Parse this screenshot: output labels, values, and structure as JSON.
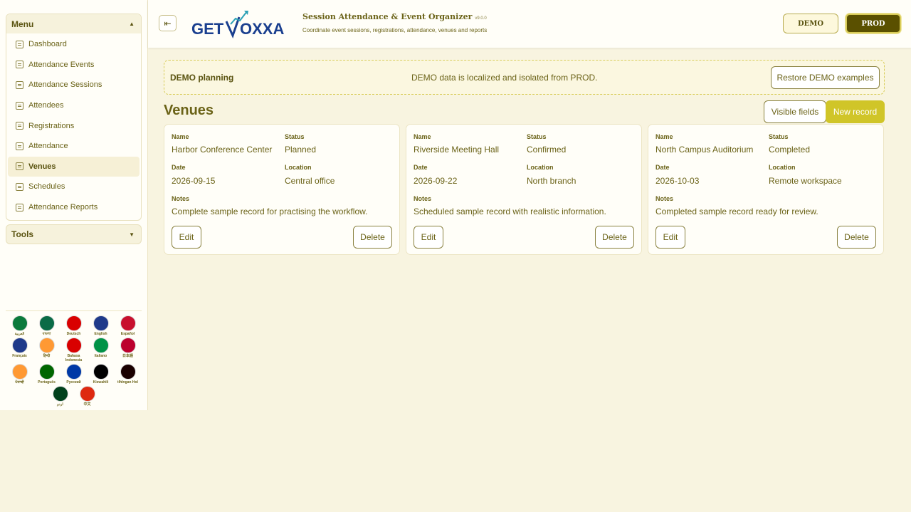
{
  "sidebar": {
    "menu_title": "Menu",
    "items": [
      {
        "label": "Dashboard"
      },
      {
        "label": "Attendance Events"
      },
      {
        "label": "Attendance Sessions"
      },
      {
        "label": "Attendees"
      },
      {
        "label": "Registrations"
      },
      {
        "label": "Attendance"
      },
      {
        "label": "Venues",
        "active": true
      },
      {
        "label": "Schedules"
      },
      {
        "label": "Attendance Reports"
      }
    ],
    "tools_title": "Tools",
    "languages": [
      [
        {
          "name": "العربية",
          "flag_color": "#0b7a3c",
          "icon": "saudi-flag-icon"
        },
        {
          "name": "বাংলা",
          "flag_color": "#0a6b46",
          "icon": "bangladesh-flag-icon"
        },
        {
          "name": "Deutsch",
          "flag_color": "#d90000",
          "icon": "germany-flag-icon"
        },
        {
          "name": "English",
          "flag_color": "#1f3a8a",
          "icon": "uk-flag-icon"
        },
        {
          "name": "Español",
          "flag_color": "#c8102e",
          "icon": "spain-flag-icon"
        }
      ],
      [
        {
          "name": "Français",
          "flag_color": "#1f3a8a",
          "icon": "france-flag-icon"
        },
        {
          "name": "हिन्दी",
          "flag_color": "#ff9933",
          "icon": "india-flag-icon"
        },
        {
          "name": "Bahasa Indonesia",
          "flag_color": "#d90000",
          "icon": "indonesia-flag-icon"
        },
        {
          "name": "Italiano",
          "flag_color": "#009246",
          "icon": "italy-flag-icon"
        },
        {
          "name": "日本語",
          "flag_color": "#bc002d",
          "icon": "japan-flag-icon"
        }
      ],
      [
        {
          "name": "ਪੰਜਾਬੀ",
          "flag_color": "#ff9933",
          "icon": "punjab-flag-icon"
        },
        {
          "name": "Português",
          "flag_color": "#006600",
          "icon": "portugal-flag-icon"
        },
        {
          "name": "Русский",
          "flag_color": "#0039a6",
          "icon": "russia-flag-icon"
        },
        {
          "name": "Kiswahili",
          "flag_color": "#000000",
          "icon": "kenya-flag-icon"
        },
        {
          "name": "tlhIngan Hol",
          "flag_color": "#1a0000",
          "icon": "klingon-flag-icon"
        }
      ],
      [
        {
          "name": "اردو",
          "flag_color": "#01411c",
          "icon": "pakistan-flag-icon"
        },
        {
          "name": "中文",
          "flag_color": "#de2910",
          "icon": "china-flag-icon"
        }
      ]
    ]
  },
  "header": {
    "logo_text_left": "GET",
    "logo_text_right": "OXXA",
    "title": "Session Attendance & Event Organizer",
    "version": "v9.0.0",
    "subtitle": "Coordinate event sessions, registrations, attendance, venues and reports",
    "demo_label": "DEMO",
    "prod_label": "PROD"
  },
  "banner": {
    "title": "DEMO planning",
    "message": "DEMO data is localized and isolated from PROD.",
    "restore_label": "Restore DEMO examples"
  },
  "section": {
    "title": "Venues",
    "visible_fields_label": "Visible fields",
    "new_record_label": "New record"
  },
  "labels": {
    "name": "Name",
    "status": "Status",
    "date": "Date",
    "location": "Location",
    "notes": "Notes",
    "edit": "Edit",
    "delete": "Delete"
  },
  "records": [
    {
      "name": "Harbor Conference Center",
      "status": "Planned",
      "date": "2026-09-15",
      "location": "Central office",
      "notes": "Complete sample record for practising the workflow."
    },
    {
      "name": "Riverside Meeting Hall",
      "status": "Confirmed",
      "date": "2026-09-22",
      "location": "North branch",
      "notes": "Scheduled sample record with realistic information."
    },
    {
      "name": "North Campus Auditorium",
      "status": "Completed",
      "date": "2026-10-03",
      "location": "Remote workspace",
      "notes": "Completed sample record ready for review."
    }
  ],
  "colors": {
    "accent": "#d0c528",
    "prod_bg": "#5a5000",
    "text": "#6b6318",
    "page_bg": "#f8f4e0"
  }
}
